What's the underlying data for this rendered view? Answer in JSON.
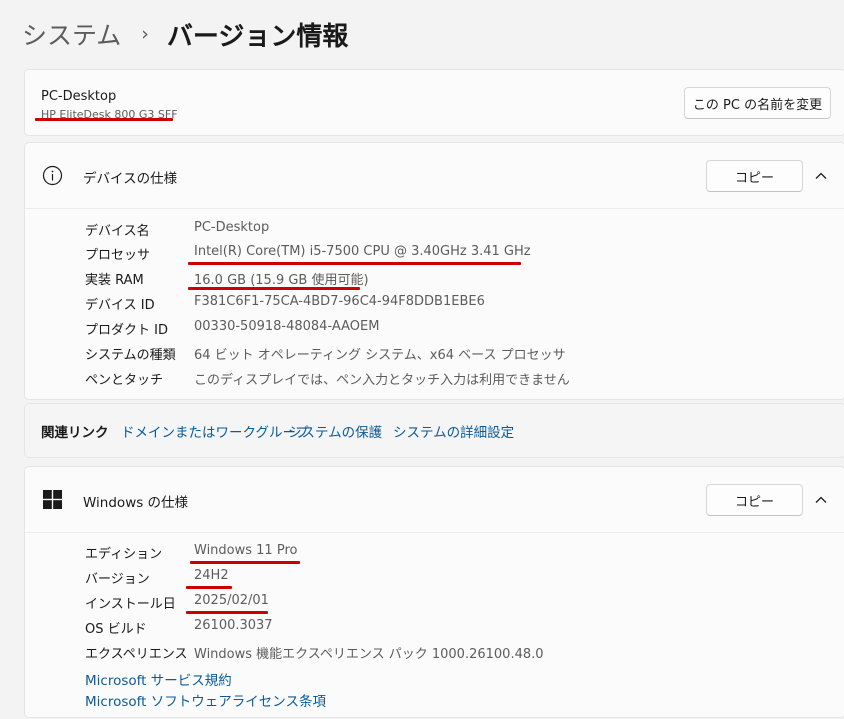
{
  "breadcrumb": {
    "parent": "システム",
    "separator": "›",
    "current": "バージョン情報"
  },
  "pc": {
    "name": "PC-Desktop",
    "model": "HP EliteDesk 800 G3 SFF",
    "rename_button": "この PC の名前を変更"
  },
  "device_specs": {
    "title": "デバイスの仕様",
    "copy_button": "コピー",
    "icon": "info-icon",
    "rows": [
      {
        "label": "デバイス名",
        "value": "PC-Desktop"
      },
      {
        "label": "プロセッサ",
        "value": "Intel(R) Core(TM) i5-7500 CPU @ 3.40GHz   3.41 GHz"
      },
      {
        "label": "実装 RAM",
        "value": "16.0 GB (15.9 GB 使用可能)"
      },
      {
        "label": "デバイス ID",
        "value": "F381C6F1-75CA-4BD7-96C4-94F8DDB1EBE6"
      },
      {
        "label": "プロダクト ID",
        "value": "00330-50918-48084-AAOEM"
      },
      {
        "label": "システムの種類",
        "value": "64 ビット オペレーティング システム、x64 ベース プロセッサ"
      },
      {
        "label": "ペンとタッチ",
        "value": "このディスプレイでは、ペン入力とタッチ入力は利用できません"
      }
    ]
  },
  "related_links": {
    "title": "関連リンク",
    "links": [
      "ドメインまたはワークグループ",
      "システムの保護",
      "システムの詳細設定"
    ]
  },
  "windows_specs": {
    "title": "Windows の仕様",
    "copy_button": "コピー",
    "icon": "windows-logo-icon",
    "rows": [
      {
        "label": "エディション",
        "value": "Windows 11 Pro"
      },
      {
        "label": "バージョン",
        "value": "24H2"
      },
      {
        "label": "インストール日",
        "value": "2025/02/01"
      },
      {
        "label": "OS ビルド",
        "value": "26100.3037"
      },
      {
        "label": "エクスペリエンス",
        "value": "Windows 機能エクスペリエンス パック 1000.26100.48.0"
      }
    ],
    "links": [
      "Microsoft サービス規約",
      "Microsoft ソフトウェアライセンス条項"
    ]
  },
  "colors": {
    "link": "#0a5a9c",
    "annotation_underline": "#cc0000",
    "background": "#f3f3f3",
    "card": "#fbfbfb"
  }
}
